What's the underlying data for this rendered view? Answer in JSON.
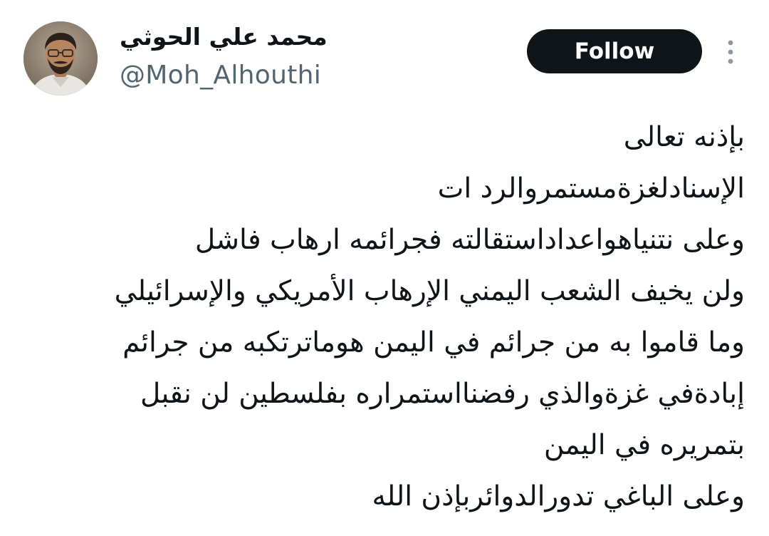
{
  "author": {
    "display_name": "محمد علي الحوثي",
    "handle": "@Moh_Alhouthi",
    "avatar_icon": "profile-photo"
  },
  "actions": {
    "follow_label": "Follow",
    "more_icon": "more-vertical-icon"
  },
  "tweet": {
    "lines": [
      "بإذنه تعالى",
      "الإسنادلغزةمستمروالرد ات",
      "وعلى نتنياهواعداداستقالته فجرائمه ارهاب فاشل",
      "ولن يخيف الشعب اليمني الإرهاب الأمريكي والإسرائيلي",
      "وما قاموا به من جرائم في اليمن هوماترتكبه من جرائم",
      "إبادةفي غزةوالذي رفضنااستمراره بفلسطين لن نقبل",
      "بتمريره في اليمن",
      "وعلى الباغي تدورالدوائربإذن الله"
    ]
  },
  "colors": {
    "text_primary": "#0f1419",
    "text_secondary": "#536471",
    "button_bg": "#0f1419",
    "button_text": "#ffffff"
  }
}
